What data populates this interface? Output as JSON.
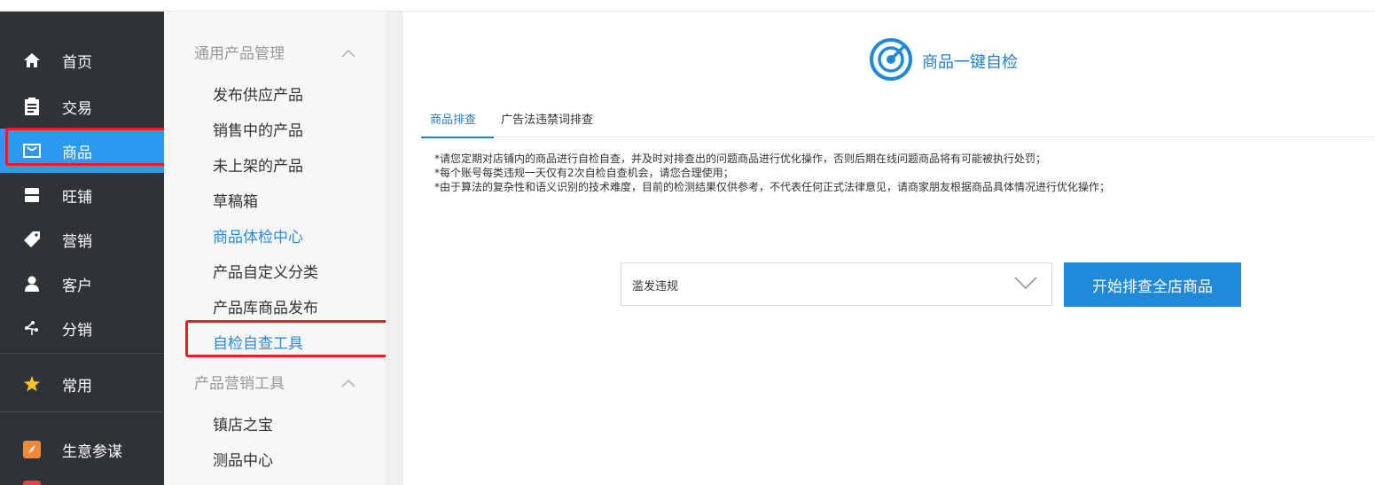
{
  "nav": {
    "items": [
      {
        "label": "首页",
        "icon": "home-icon"
      },
      {
        "label": "交易",
        "icon": "clipboard-icon"
      },
      {
        "label": "商品",
        "icon": "bag-icon"
      },
      {
        "label": "旺铺",
        "icon": "shop-icon"
      },
      {
        "label": "营销",
        "icon": "tag-icon"
      },
      {
        "label": "客户",
        "icon": "person-icon"
      },
      {
        "label": "分销",
        "icon": "share-icon"
      },
      {
        "label": "常用",
        "icon": "star-icon"
      },
      {
        "label": "生意参谋",
        "icon": "compass-icon"
      }
    ],
    "active": "商品"
  },
  "subnav": {
    "group1": {
      "title": "通用产品管理",
      "items": [
        "发布供应产品",
        "销售中的产品",
        "未上架的产品",
        "草稿箱",
        "商品体检中心",
        "产品自定义分类",
        "产品库商品发布",
        "自检自查工具"
      ]
    },
    "group2": {
      "title": "产品营销工具",
      "items": [
        "镇店之宝",
        "测品中心"
      ]
    }
  },
  "main": {
    "title": "商品一键自检",
    "tabs": [
      "商品排查",
      "广告法违禁词排查"
    ],
    "notes": [
      "*请您定期对店铺内的商品进行自检自查，并及时对排查出的问题商品进行优化操作，否则后期在线问题商品将有可能被执行处罚；",
      "*每个账号每类违规一天仅有2次自检自查机会，请您合理使用；",
      "*由于算法的复杂性和语义识别的技术难度，目前的检测结果仅供参考，不代表任何正式法律意见，请商家朋友根据商品具体情况进行优化操作；"
    ],
    "select_value": "滥发违规",
    "start_button": "开始排查全店商品"
  },
  "colors": {
    "nav_bg": "#2f3237",
    "nav_active": "#2a9bf0",
    "accent": "#1f7fd6",
    "highlight_box": "#ee1c25"
  }
}
